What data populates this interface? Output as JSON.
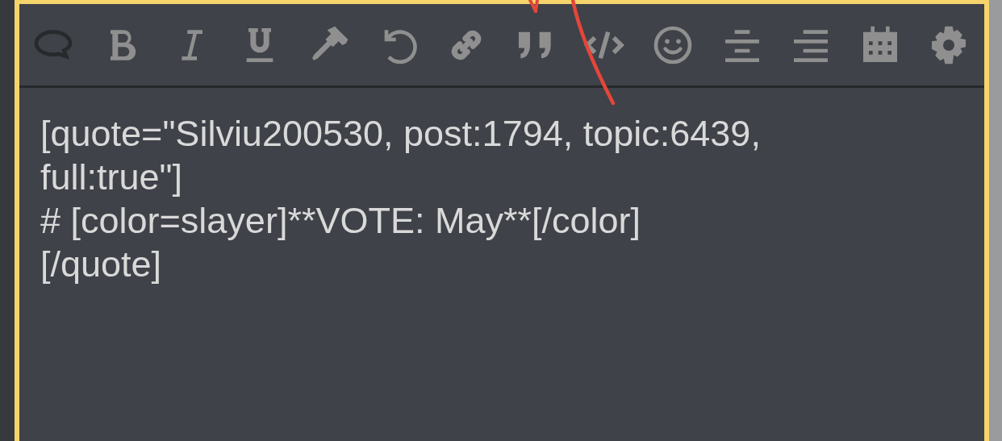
{
  "toolbar": [
    {
      "kind": "speech",
      "disabled": true
    },
    {
      "kind": "bold",
      "disabled": false
    },
    {
      "kind": "italic",
      "disabled": false
    },
    {
      "kind": "underline",
      "disabled": false
    },
    {
      "kind": "hammer",
      "disabled": false
    },
    {
      "kind": "undo",
      "disabled": false
    },
    {
      "kind": "link",
      "disabled": false
    },
    {
      "kind": "quote",
      "disabled": false
    },
    {
      "kind": "code",
      "disabled": false
    },
    {
      "kind": "smiley",
      "disabled": false
    },
    {
      "kind": "center",
      "disabled": false
    },
    {
      "kind": "right",
      "disabled": false
    },
    {
      "kind": "calendar",
      "disabled": false
    },
    {
      "kind": "gear",
      "disabled": false
    }
  ],
  "editor": {
    "value": "[quote=\"Silviu200530, post:1794, topic:6439, full:true\"]\n# [color=slayer]**VOTE: May**[/color]\n[/quote]"
  }
}
